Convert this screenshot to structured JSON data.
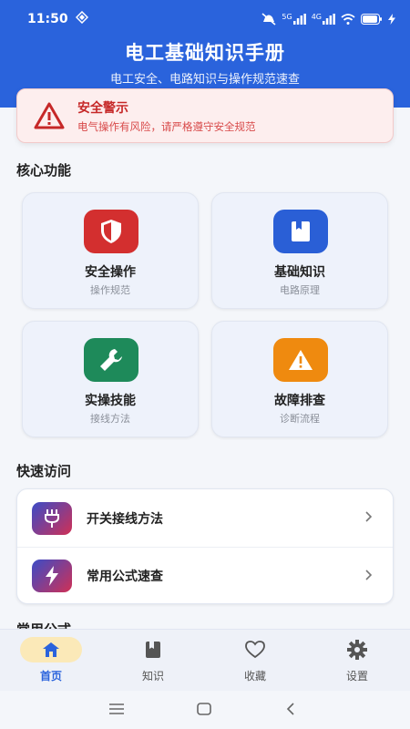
{
  "status_bar": {
    "time": "11:50",
    "net_label_1": "5G",
    "net_label_2": "4G"
  },
  "header": {
    "title": "电工基础知识手册",
    "subtitle": "电工安全、电路知识与操作规范速查"
  },
  "warning": {
    "title": "安全警示",
    "desc": "电气操作有风险，请严格遵守安全规范",
    "color": "#c62828"
  },
  "sections": {
    "core": "核心功能",
    "quick": "快速访问",
    "formulas": "常用公式"
  },
  "cards": [
    {
      "title": "安全操作",
      "sub": "操作规范",
      "icon": "shield-icon",
      "color": "#d32f2f"
    },
    {
      "title": "基础知识",
      "sub": "电路原理",
      "icon": "book-icon",
      "color": "#2a5fd6"
    },
    {
      "title": "实操技能",
      "sub": "接线方法",
      "icon": "wrench-icon",
      "color": "#1e8a5a"
    },
    {
      "title": "故障排查",
      "sub": "诊断流程",
      "icon": "warning-icon",
      "color": "#ef8a0f"
    }
  ],
  "quick_access": [
    {
      "label": "开关接线方法",
      "icon": "plug-icon"
    },
    {
      "label": "常用公式速查",
      "icon": "lightning-icon"
    }
  ],
  "bottom_nav": [
    {
      "label": "首页",
      "icon": "home-icon",
      "active": true
    },
    {
      "label": "知识",
      "icon": "book-icon",
      "active": false
    },
    {
      "label": "收藏",
      "icon": "heart-icon",
      "active": false
    },
    {
      "label": "设置",
      "icon": "gear-icon",
      "active": false
    }
  ],
  "colors": {
    "primary": "#2a63dc",
    "active_pill": "#fbe9b8"
  }
}
